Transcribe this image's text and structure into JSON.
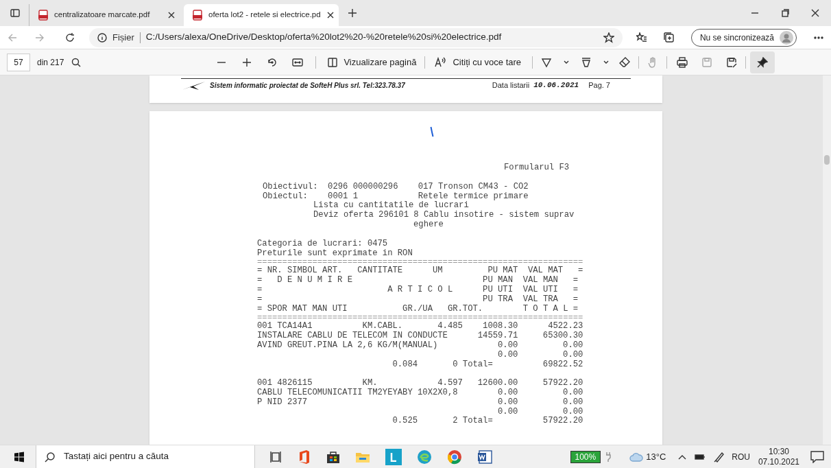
{
  "tabs": [
    {
      "title": "centralizatoare marcate.pdf",
      "selected": false
    },
    {
      "title": "oferta lot2 - retele si electrice.pd",
      "selected": true
    }
  ],
  "address_bar": {
    "scheme_label": "Fișier",
    "url": "C:/Users/alexa/OneDrive/Desktop/oferta%20lot2%20-%20retele%20si%20electrice.pdf"
  },
  "profile_button": "Nu se sincronizează",
  "pdf_toolbar": {
    "page": "57",
    "page_count": "din 217",
    "page_view": "Vizualizare pagină",
    "read_aloud": "Citiți cu voce tare"
  },
  "previous_page_footer": {
    "company": "Sistem informatic proiectat de SofteH Plus srl. Tel:323.78.37",
    "date_label": "Data listarii",
    "date": "10.06.2021",
    "page": "Pag. 7"
  },
  "page": {
    "form": "Formularul F3",
    "objective_lines": [
      "Obiectivul:  0296 000000296    017 Tronson CM43 - CO2",
      "Obiectul:    0001 1            Retele termice primare"
    ],
    "list_title": "Lista cu cantitatile de lucrari",
    "estimate_lines": [
      "Deviz oferta 296101 8 Cablu insotire - sistem suprav",
      "eghere"
    ],
    "category": "Categoria de lucrari: 0475",
    "currency_note": "Preturile sunt exprimate in RON",
    "separator": "=================================================================",
    "header_lines": [
      "= NR. SIMBOL ART.   CANTITATE      UM         PU MAT  VAL MAT   =",
      "=   D E N U M I R E                          PU MAN  VAL MAN   =",
      "=                         A R T I C O L      PU UTI  VAL UTI   =",
      "=                                            PU TRA  VAL TRA   =",
      "= SPOR MAT MAN UTI           GR./UA   GR.TOT.        T O T A L ="
    ],
    "items": [
      {
        "nr": "001",
        "symbol": "TCA14A1",
        "um": "KM.CABL.",
        "qty": "4.485",
        "pu": "1008.30",
        "val": "4522.23",
        "lines": [
          {
            "text": "INSTALARE CABLU DE TELECOM IN CONDUCTE",
            "pu": "14559.71",
            "val": "65300.30"
          },
          {
            "text": "AVIND GREUT.PINA LA 2,6 KG/M(MANUAL)",
            "pu": "0.00",
            "val": "0.00"
          },
          {
            "pu": "0.00",
            "val": "0.00"
          }
        ],
        "total": {
          "gr_ua": "0.084",
          "gr_tot": "0",
          "label": "Total=",
          "value": "69822.52"
        }
      },
      {
        "nr": "001",
        "symbol": "4826115",
        "um": "KM.",
        "qty": "4.597",
        "pu": "12600.00",
        "val": "57922.20",
        "lines": [
          {
            "text": "CABLU TELECOMUNICATII TM2YEYABY 10X2X0,8",
            "pu": "0.00",
            "val": "0.00"
          },
          {
            "text": "P NID 2377",
            "pu": "0.00",
            "val": "0.00"
          },
          {
            "pu": "0.00",
            "val": "0.00"
          }
        ],
        "total": {
          "gr_ua": "0.525",
          "gr_tot": "2",
          "label": "Total=",
          "value": "57922.20"
        }
      }
    ]
  },
  "taskbar": {
    "search_placeholder": "Tastați aici pentru a căuta",
    "battery": "100%",
    "temperature": "13°C",
    "language": "ROU",
    "time": "10:30",
    "date": "07.10.2021"
  }
}
